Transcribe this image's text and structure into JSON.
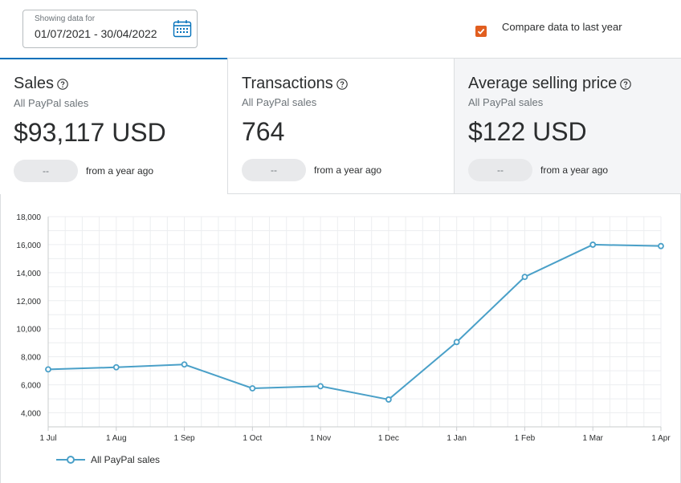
{
  "date_range": {
    "caption": "Showing data for",
    "value": "01/07/2021 - 30/04/2022",
    "icon": "calendar-icon"
  },
  "compare": {
    "label": "Compare data to last year",
    "checked": true,
    "color": "#e15e1f"
  },
  "tabs": [
    {
      "title": "Sales",
      "subtitle": "All PayPal sales",
      "value": "$93,117 USD",
      "delta": "--",
      "delta_text": "from a year ago",
      "active": true
    },
    {
      "title": "Transactions",
      "subtitle": "All PayPal sales",
      "value": "764",
      "delta": "--",
      "delta_text": "from a year ago",
      "active": false
    },
    {
      "title": "Average selling price",
      "subtitle": "All PayPal sales",
      "value": "$122 USD",
      "delta": "--",
      "delta_text": "from a year ago",
      "active": false
    }
  ],
  "colors": {
    "accent": "#0070ba",
    "line": "#4aa0c8"
  },
  "chart_data": {
    "type": "line",
    "categories": [
      "1 Jul",
      "1 Aug",
      "1 Sep",
      "1 Oct",
      "1 Nov",
      "1 Dec",
      "1 Jan",
      "1 Feb",
      "1 Mar",
      "1 Apr"
    ],
    "series": [
      {
        "name": "All PayPal sales",
        "values": [
          7100,
          7250,
          7450,
          5750,
          5900,
          4950,
          9050,
          13700,
          16000,
          15900
        ]
      }
    ],
    "ylim": [
      3000,
      18000
    ],
    "yticks": [
      4000,
      6000,
      8000,
      10000,
      12000,
      14000,
      16000,
      18000
    ],
    "ytick_labels": [
      "4,000",
      "6,000",
      "8,000",
      "10,000",
      "12,000",
      "14,000",
      "16,000",
      "18,000"
    ],
    "grid": true,
    "legend": "bottom-left"
  }
}
